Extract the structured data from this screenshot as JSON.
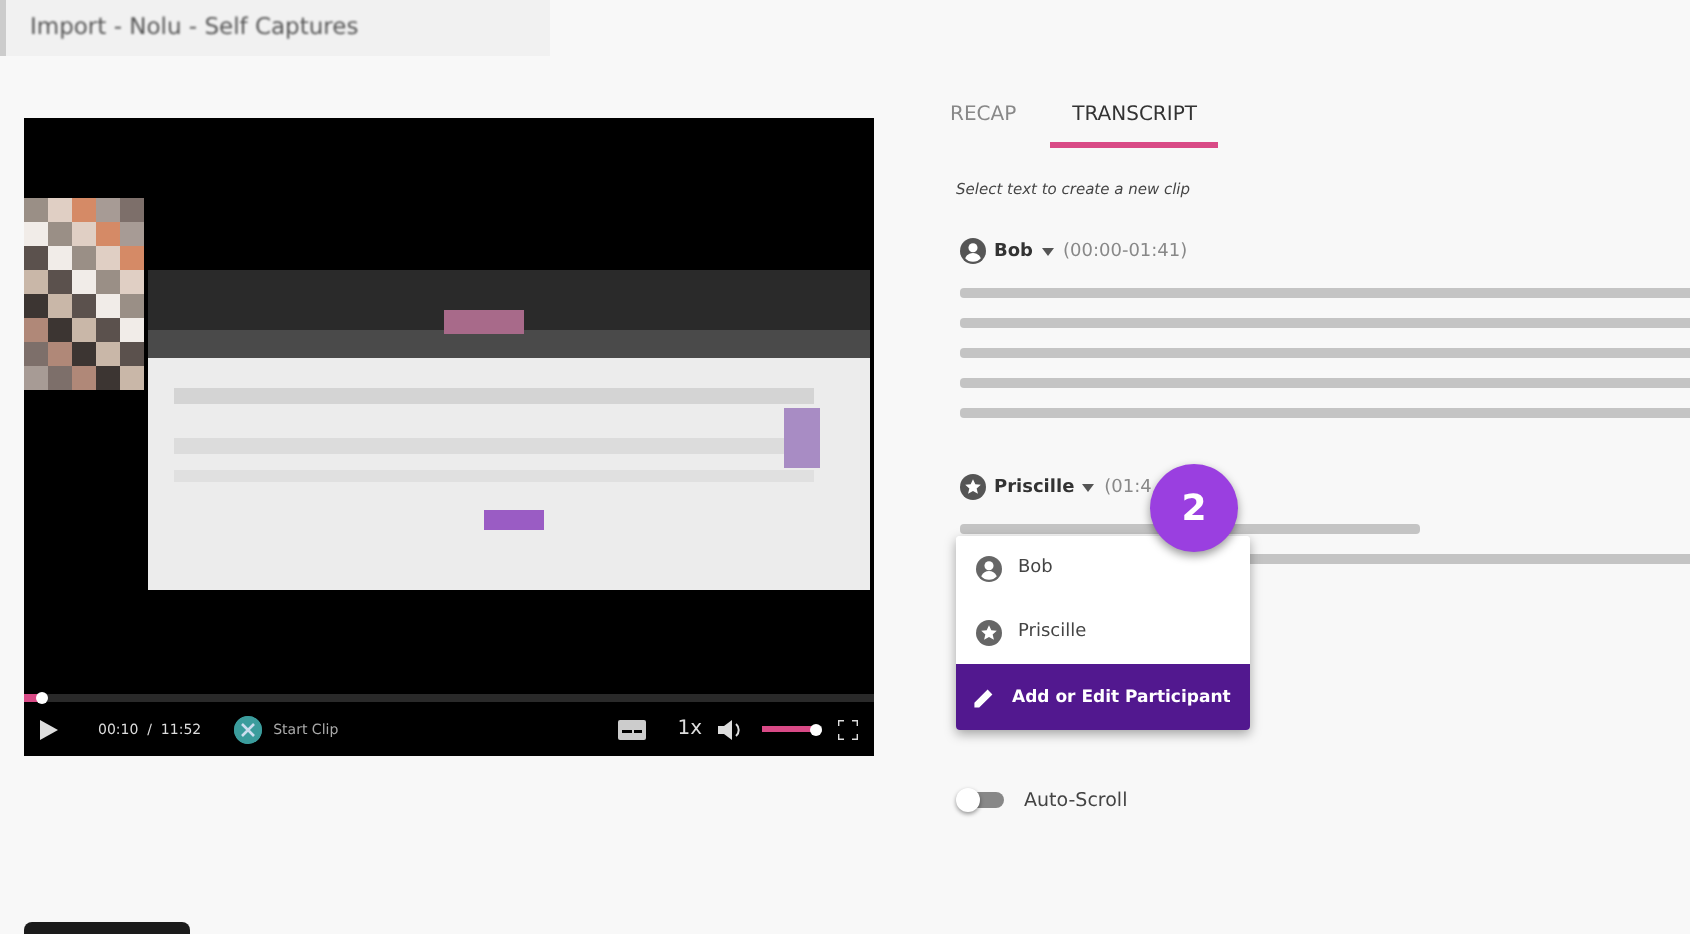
{
  "window": {
    "title": "Import - Nolu - Self Captures"
  },
  "player": {
    "progress": {
      "level": 0.02
    },
    "time": {
      "current": "00:10",
      "separator": "/",
      "total": "11:52"
    },
    "start_clip": "Start Clip",
    "speed": "1x",
    "volume": {
      "level": 0.9
    }
  },
  "tabs": [
    {
      "label": "RECAP",
      "selected": false
    },
    {
      "label": "TRANSCRIPT",
      "selected": true
    }
  ],
  "hint": "Select text to create a new clip",
  "segments": [
    {
      "speaker": "Bob",
      "kind": "person",
      "time": "(00:00-01:41)"
    },
    {
      "speaker": "Priscille",
      "kind": "star",
      "time": "(01:4"
    }
  ],
  "menu": {
    "items": [
      {
        "label": "Bob",
        "kind": "person"
      },
      {
        "label": "Priscille",
        "kind": "star"
      },
      {
        "label": "Add or Edit Participant",
        "kind": "action"
      }
    ]
  },
  "step_badge": "2",
  "auto_scroll": {
    "label": "Auto-Scroll",
    "on": false
  }
}
